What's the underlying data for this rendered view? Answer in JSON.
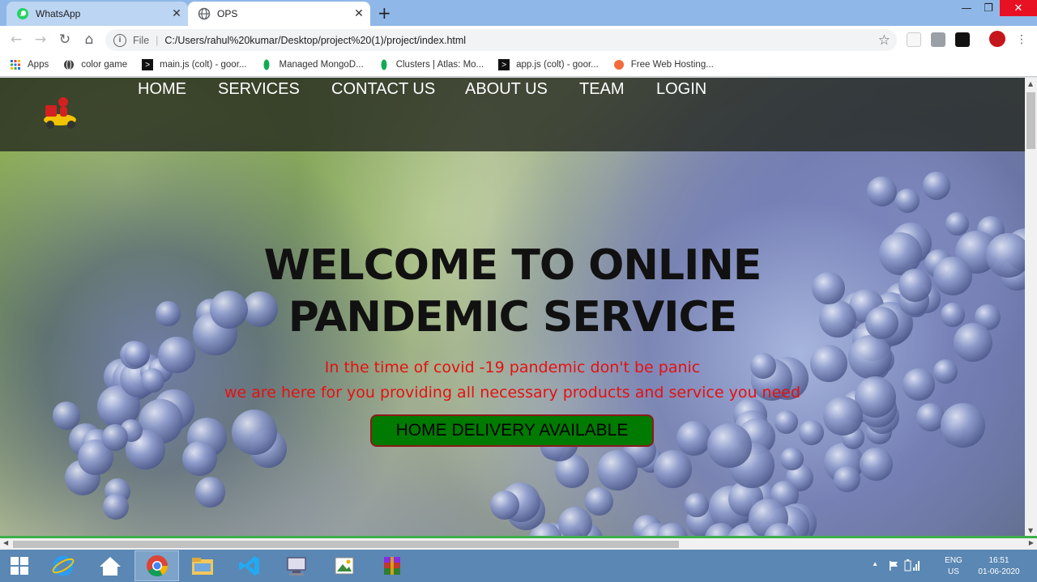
{
  "browser": {
    "tabs": [
      {
        "title": "WhatsApp",
        "icon": "whatsapp-icon"
      },
      {
        "title": "OPS",
        "icon": "globe-icon"
      }
    ],
    "url_scheme": "File",
    "url": "C:/Users/rahul%20kumar/Desktop/project%20(1)/project/index.html"
  },
  "bookmarks": [
    {
      "label": "Apps",
      "icon": "apps-grid-icon"
    },
    {
      "label": "color game",
      "icon": "globe-icon"
    },
    {
      "label": "main.js (colt) - goor...",
      "icon": "terminal-icon"
    },
    {
      "label": "Managed MongoD...",
      "icon": "mongodb-leaf-icon"
    },
    {
      "label": "Clusters | Atlas: Mo...",
      "icon": "mongodb-leaf-icon"
    },
    {
      "label": "app.js (colt) - goor...",
      "icon": "terminal-icon"
    },
    {
      "label": "Free Web Hosting...",
      "icon": "hosting-icon"
    }
  ],
  "page": {
    "nav": [
      "HOME",
      "SERVICES",
      "CONTACT US",
      "ABOUT US",
      "TEAM",
      "LOGIN"
    ],
    "title_line1": "WELCOME TO ONLINE",
    "title_line2": "PANDEMIC SERVICE",
    "sub_line1": "In the time of covid -19 pandemic don't be panic",
    "sub_line2": "we are here for you providing all necessary products and service you need",
    "cta": "HOME DELIVERY AVAILABLE"
  },
  "taskbar": {
    "lang_top": "ENG",
    "lang_bottom": "US",
    "time": "16:51",
    "date": "01-06-2020"
  },
  "colors": {
    "subtitle": "#e61010",
    "cta_bg": "#007a00",
    "cta_border": "#8b1a1a"
  }
}
